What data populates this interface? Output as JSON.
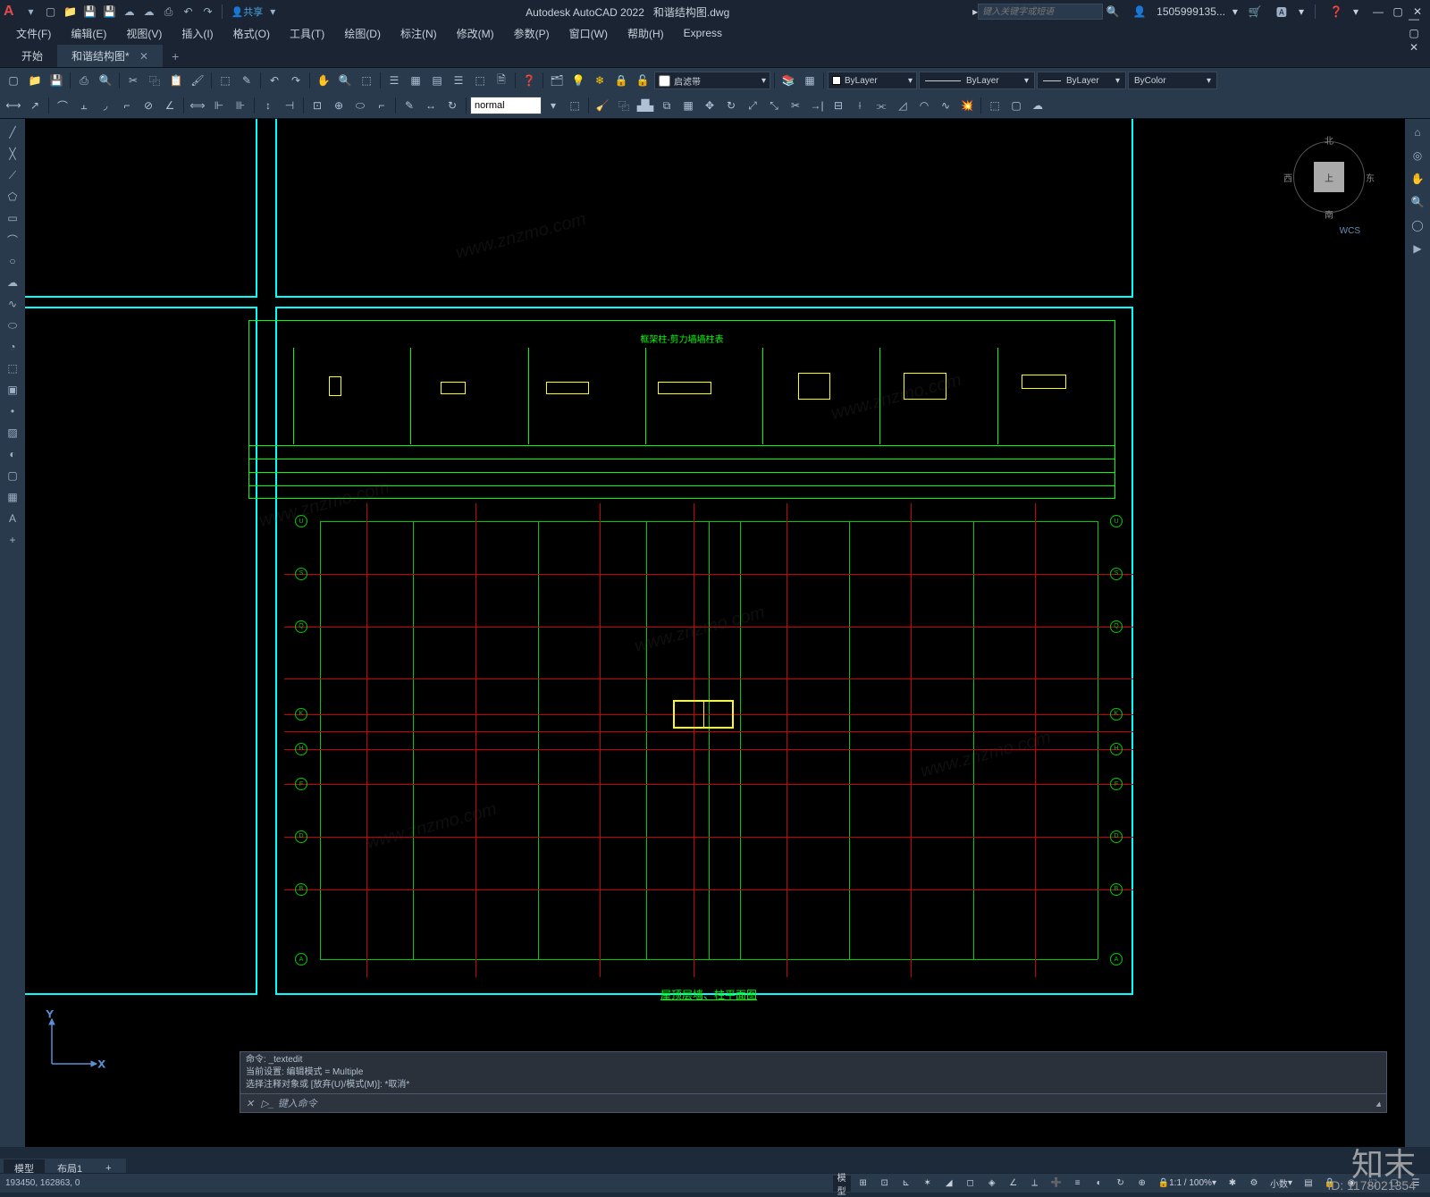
{
  "app": {
    "title": "Autodesk AutoCAD 2022",
    "filename": "和谐结构图.dwg",
    "user": "1505999135...",
    "search_placeholder": "键入关键字或短语"
  },
  "share": {
    "label": "共享"
  },
  "menu": {
    "file": "文件(F)",
    "edit": "编辑(E)",
    "view": "视图(V)",
    "insert": "插入(I)",
    "format": "格式(O)",
    "tools": "工具(T)",
    "draw": "绘图(D)",
    "dimension": "标注(N)",
    "modify": "修改(M)",
    "parametric": "参数(P)",
    "window": "窗口(W)",
    "help": "帮助(H)",
    "express": "Express"
  },
  "tabs": {
    "start": "开始",
    "file1": "和谐结构图*"
  },
  "ribbon": {
    "layer_checkbox": "启滤带",
    "layer_name": "ByLayer",
    "linetype": "ByLayer",
    "lineweight": "ByLayer",
    "color": "ByColor",
    "text_style": "normal"
  },
  "viewcube": {
    "n": "北",
    "s": "南",
    "e": "东",
    "w": "西",
    "top": "上",
    "wcs": "WCS"
  },
  "cmd": {
    "hist1": "命令: _textedit",
    "hist2": "当前设置: 编辑模式 = Multiple",
    "hist3": "选择注释对象或 [放弃(U)/模式(M)]: *取消*",
    "prompt": "键入命令"
  },
  "model_tabs": {
    "model": "模型",
    "layout1": "布局1",
    "add": "+"
  },
  "status": {
    "coords": "193450, 162863, 0",
    "model_btn": "模型",
    "scale": "1:1 / 100%",
    "decimal": "小数"
  },
  "drawing": {
    "schedule_title": "框架柱-剪力墙墙柱表",
    "plan_title": "屋顶层墙、柱平面图"
  },
  "watermark": {
    "logo": "知末",
    "id": "ID: 1178021354",
    "url": "www.znzmo.com"
  }
}
